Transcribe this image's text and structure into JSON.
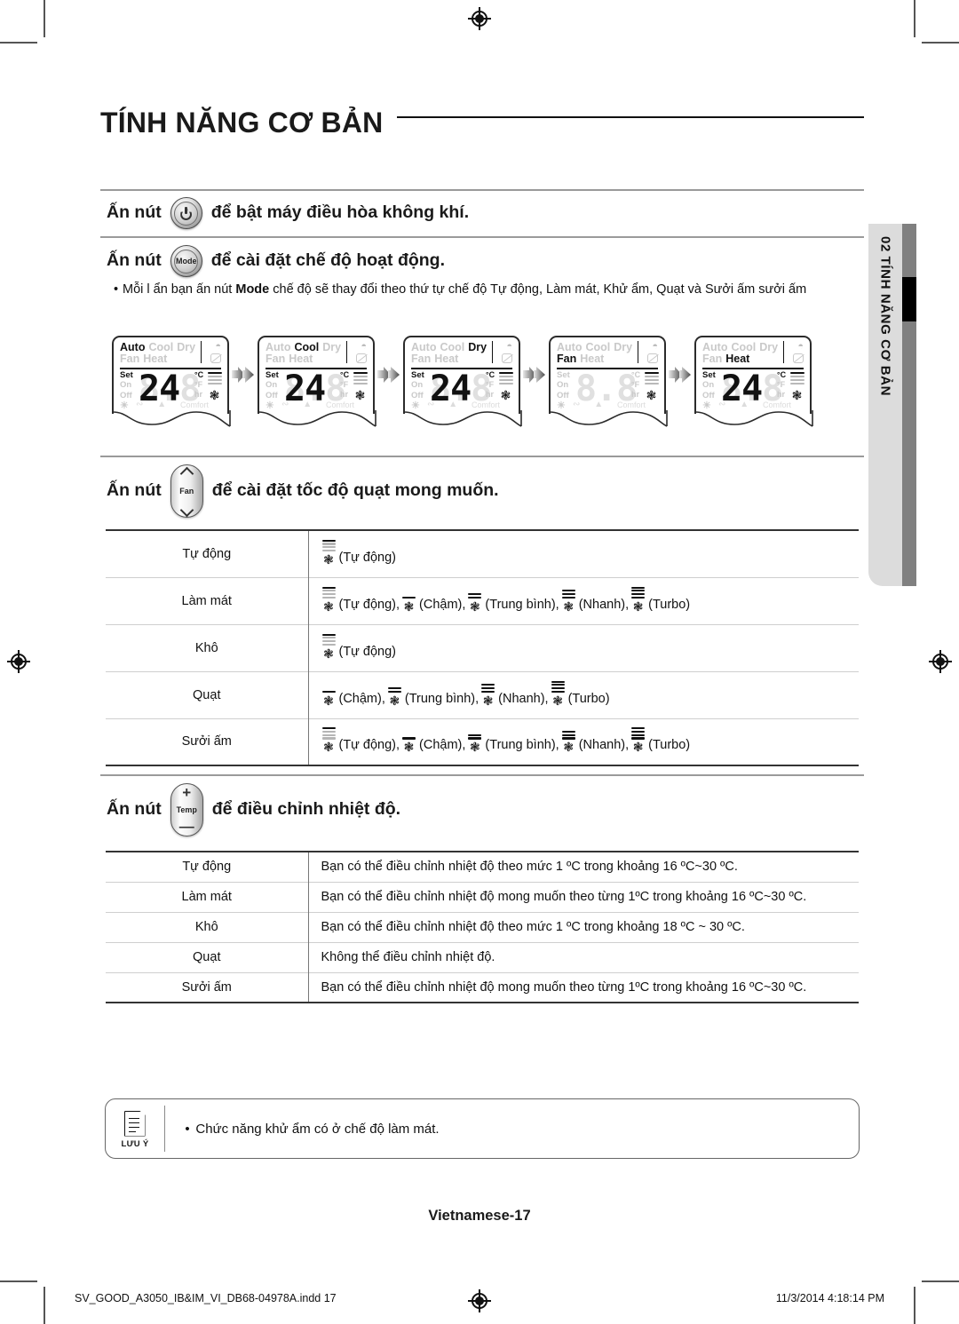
{
  "page": {
    "title": "TÍNH NĂNG CƠ BẢN",
    "page_label": "Vietnamese-17",
    "side_tab": "02  TÍNH NĂNG CƠ BẢN"
  },
  "footer": {
    "file": "SV_GOOD_A3050_IB&IM_VI_DB68-04978A.indd   17",
    "timestamp": "11/3/2014   4:18:14 PM"
  },
  "sections": {
    "power": {
      "prefix": "Ấn nút",
      "button_icon": "power-icon",
      "suffix": "để bật máy điều hòa không khí."
    },
    "mode": {
      "prefix": "Ấn nút",
      "button_label": "Mode",
      "suffix": "để cài đặt chế độ hoạt động.",
      "bullet_pre": "Mỗi l ẩn bạn ấn nút ",
      "bullet_bold": "Mode",
      "bullet_post": " chế độ sẽ thay đổi theo thứ tự chế độ Tự động, Làm mát, Khử ẩm, Quạt và Sưởi ấm sưởi ấm"
    },
    "fan": {
      "prefix": "Ấn nút",
      "button_label": "Fan",
      "suffix": "để cài đặt tốc độ quạt mong muốn."
    },
    "temp": {
      "prefix": "Ấn nút",
      "button_label": "Temp",
      "button_plus": "+",
      "button_minus": "—",
      "suffix": "để điều chỉnh nhiệt độ."
    }
  },
  "lcd_panels": [
    {
      "active_mode": "Auto",
      "modes_top": [
        "Auto",
        "Cool",
        "Dry"
      ],
      "modes_bottom": [
        "Fan",
        "Heat"
      ],
      "set_label": "Set",
      "on_label": "On",
      "off_label": "Off",
      "ghost_digits": "8.8",
      "digits": "24",
      "unit_c": "°C",
      "unit_f": "°F",
      "unit_hr": "hr",
      "fan_bars": 4,
      "fan_bars_on": 1,
      "temp_shown": true,
      "comfort_label": "Comfort"
    },
    {
      "active_mode": "Cool",
      "modes_top": [
        "Auto",
        "Cool",
        "Dry"
      ],
      "modes_bottom": [
        "Fan",
        "Heat"
      ],
      "set_label": "Set",
      "on_label": "On",
      "off_label": "Off",
      "ghost_digits": "8.8",
      "digits": "24",
      "unit_c": "°C",
      "unit_f": "°F",
      "unit_hr": "hr",
      "fan_bars": 4,
      "fan_bars_on": 1,
      "temp_shown": true,
      "comfort_label": "Comfort"
    },
    {
      "active_mode": "Dry",
      "modes_top": [
        "Auto",
        "Cool",
        "Dry"
      ],
      "modes_bottom": [
        "Fan",
        "Heat"
      ],
      "set_label": "Set",
      "on_label": "On",
      "off_label": "Off",
      "ghost_digits": "8.8",
      "digits": "24",
      "unit_c": "°C",
      "unit_f": "°F",
      "unit_hr": "hr",
      "fan_bars": 4,
      "fan_bars_on": 1,
      "temp_shown": true,
      "comfort_label": "Comfort"
    },
    {
      "active_mode": "Fan",
      "modes_top": [
        "Auto",
        "Cool",
        "Dry"
      ],
      "modes_bottom": [
        "Fan",
        "Heat"
      ],
      "set_label": "Set",
      "on_label": "On",
      "off_label": "Off",
      "ghost_digits": "8.8",
      "digits": "",
      "unit_c": "°C",
      "unit_f": "°F",
      "unit_hr": "hr",
      "fan_bars": 4,
      "fan_bars_on": 1,
      "temp_shown": false,
      "comfort_label": "Comfort"
    },
    {
      "active_mode": "Heat",
      "modes_top": [
        "Auto",
        "Cool",
        "Dry"
      ],
      "modes_bottom": [
        "Fan",
        "Heat"
      ],
      "set_label": "Set",
      "on_label": "On",
      "off_label": "Off",
      "ghost_digits": "8.8",
      "digits": "24",
      "unit_c": "°C",
      "unit_f": "°F",
      "unit_hr": "hr",
      "fan_bars": 4,
      "fan_bars_on": 1,
      "temp_shown": true,
      "comfort_label": "Comfort"
    }
  ],
  "fan_speed_table": {
    "rows": [
      {
        "mode": "Tự động",
        "options": [
          {
            "label": "(Tự động)",
            "bars": "auto"
          }
        ]
      },
      {
        "mode": "Làm mát",
        "options": [
          {
            "label": "(Tự động),",
            "bars": "auto"
          },
          {
            "label": "(Chậm),",
            "bars": 1
          },
          {
            "label": "(Trung bình),",
            "bars": 2
          },
          {
            "label": "(Nhanh),",
            "bars": 3
          },
          {
            "label": "(Turbo)",
            "bars": 4
          }
        ]
      },
      {
        "mode": "Khô",
        "options": [
          {
            "label": "(Tự động)",
            "bars": "auto"
          }
        ]
      },
      {
        "mode": "Quạt",
        "options": [
          {
            "label": "(Chậm),",
            "bars": 1
          },
          {
            "label": "(Trung bình),",
            "bars": 2
          },
          {
            "label": "(Nhanh),",
            "bars": 3
          },
          {
            "label": "(Turbo)",
            "bars": 4
          }
        ]
      },
      {
        "mode": "Sưởi ấm",
        "options": [
          {
            "label": "(Tự động),",
            "bars": "auto"
          },
          {
            "label": "(Chậm),",
            "bars": 1
          },
          {
            "label": "(Trung bình),",
            "bars": 2
          },
          {
            "label": "(Nhanh),",
            "bars": 3
          },
          {
            "label": "(Turbo)",
            "bars": 4
          }
        ]
      }
    ]
  },
  "temperature_table": {
    "rows": [
      {
        "mode": "Tự động",
        "desc": "Bạn có thể điều chỉnh nhiệt độ theo mức 1 ºC trong khoảng 16 ºC~30 ºC."
      },
      {
        "mode": "Làm mát",
        "desc": "Bạn có thể điều chỉnh nhiệt độ mong muốn theo từng 1ºC trong khoảng 16 ºC~30 ºC."
      },
      {
        "mode": "Khô",
        "desc": "Bạn có thể điều chỉnh nhiệt độ theo mức 1 ºC trong khoảng 18 ºC ~ 30 ºC."
      },
      {
        "mode": "Quạt",
        "desc": "Không thể điều chỉnh nhiệt độ."
      },
      {
        "mode": "Sưởi ấm",
        "desc": "Bạn có thể điều chỉnh nhiệt độ mong muốn theo từng 1ºC trong khoảng 16 ºC~30 ºC."
      }
    ]
  },
  "note": {
    "icon_label": "LƯU Ý",
    "text": "Chức năng khử ẩm có ở chế độ làm mát."
  }
}
